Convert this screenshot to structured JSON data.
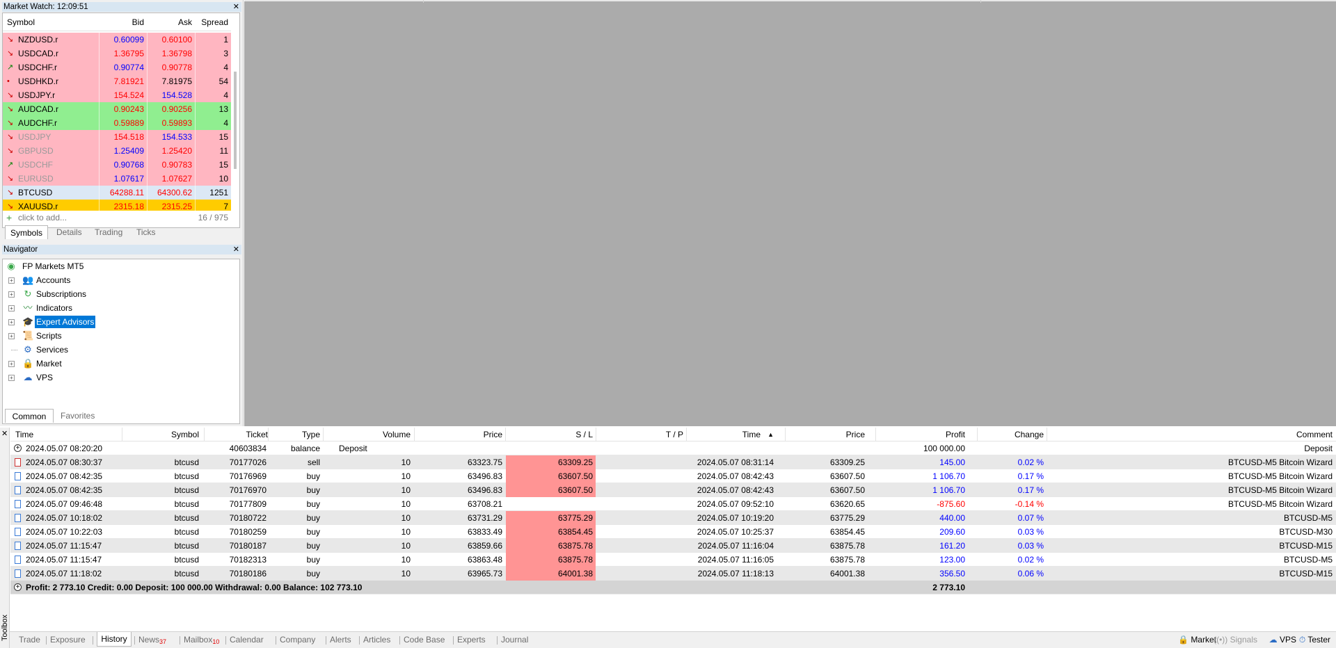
{
  "market_watch": {
    "title": "Market Watch: 12:09:51",
    "columns": {
      "symbol": "Symbol",
      "bid": "Bid",
      "ask": "Ask",
      "spread": "Spread"
    },
    "rows": [
      {
        "symbol": "NZDUSD.r",
        "bid": "0.60099",
        "ask": "0.60100",
        "spread": "1",
        "bg": "#ffb6c1",
        "arrow": "↘",
        "arrow_color": "#cc0000",
        "bid_color": "#0000ff",
        "ask_color": "#ff0000",
        "sym_color": "#000000"
      },
      {
        "symbol": "USDCAD.r",
        "bid": "1.36795",
        "ask": "1.36798",
        "spread": "3",
        "bg": "#ffb6c1",
        "arrow": "↘",
        "arrow_color": "#cc0000",
        "bid_color": "#ff0000",
        "ask_color": "#ff0000",
        "sym_color": "#000000"
      },
      {
        "symbol": "USDCHF.r",
        "bid": "0.90774",
        "ask": "0.90778",
        "spread": "4",
        "bg": "#ffb6c1",
        "arrow": "↗",
        "arrow_color": "#008000",
        "bid_color": "#0000ff",
        "ask_color": "#ff0000",
        "sym_color": "#000000"
      },
      {
        "symbol": "USDHKD.r",
        "bid": "7.81921",
        "ask": "7.81975",
        "spread": "54",
        "bg": "#ffb6c1",
        "arrow": "•",
        "arrow_color": "#cc0000",
        "bid_color": "#ff0000",
        "ask_color": "#000000",
        "sym_color": "#000000"
      },
      {
        "symbol": "USDJPY.r",
        "bid": "154.524",
        "ask": "154.528",
        "spread": "4",
        "bg": "#ffb6c1",
        "arrow": "↘",
        "arrow_color": "#cc0000",
        "bid_color": "#ff0000",
        "ask_color": "#0000ff",
        "sym_color": "#000000"
      },
      {
        "symbol": "AUDCAD.r",
        "bid": "0.90243",
        "ask": "0.90256",
        "spread": "13",
        "bg": "#90ee90",
        "arrow": "↘",
        "arrow_color": "#cc0000",
        "bid_color": "#ff0000",
        "ask_color": "#ff0000",
        "sym_color": "#000000"
      },
      {
        "symbol": "AUDCHF.r",
        "bid": "0.59889",
        "ask": "0.59893",
        "spread": "4",
        "bg": "#90ee90",
        "arrow": "↘",
        "arrow_color": "#cc0000",
        "bid_color": "#ff0000",
        "ask_color": "#ff0000",
        "sym_color": "#000000"
      },
      {
        "symbol": "USDJPY",
        "bid": "154.518",
        "ask": "154.533",
        "spread": "15",
        "bg": "#ffb6c1",
        "arrow": "↘",
        "arrow_color": "#cc0000",
        "bid_color": "#ff0000",
        "ask_color": "#0000ff",
        "sym_color": "#9a9a9a"
      },
      {
        "symbol": "GBPUSD",
        "bid": "1.25409",
        "ask": "1.25420",
        "spread": "11",
        "bg": "#ffb6c1",
        "arrow": "↘",
        "arrow_color": "#cc0000",
        "bid_color": "#0000ff",
        "ask_color": "#ff0000",
        "sym_color": "#9a9a9a"
      },
      {
        "symbol": "USDCHF",
        "bid": "0.90768",
        "ask": "0.90783",
        "spread": "15",
        "bg": "#ffb6c1",
        "arrow": "↗",
        "arrow_color": "#008000",
        "bid_color": "#0000ff",
        "ask_color": "#ff0000",
        "sym_color": "#9a9a9a"
      },
      {
        "symbol": "EURUSD",
        "bid": "1.07617",
        "ask": "1.07627",
        "spread": "10",
        "bg": "#ffb6c1",
        "arrow": "↘",
        "arrow_color": "#cc0000",
        "bid_color": "#0000ff",
        "ask_color": "#ff0000",
        "sym_color": "#9a9a9a"
      },
      {
        "symbol": "BTCUSD",
        "bid": "64288.11",
        "ask": "64300.62",
        "spread": "1251",
        "bg": "#dce8f5",
        "arrow": "↘",
        "arrow_color": "#cc0000",
        "bid_color": "#ff0000",
        "ask_color": "#ff0000",
        "sym_color": "#000000"
      },
      {
        "symbol": "XAUUSD.r",
        "bid": "2315.18",
        "ask": "2315.25",
        "spread": "7",
        "bg": "#ffcc00",
        "arrow": "↘",
        "arrow_color": "#cc0000",
        "bid_color": "#ff0000",
        "ask_color": "#ff0000",
        "sym_color": "#000000"
      }
    ],
    "add_label": "click to add...",
    "count": "16 / 975",
    "tabs": [
      "Symbols",
      "Details",
      "Trading",
      "Ticks"
    ]
  },
  "navigator": {
    "title": "Navigator",
    "root": "FP Markets MT5",
    "items": [
      {
        "label": "Accounts",
        "icon": "accounts-icon",
        "glyph": "👥",
        "color": "#2b6cc4",
        "expandable": true
      },
      {
        "label": "Subscriptions",
        "icon": "subscriptions-icon",
        "glyph": "↻",
        "color": "#3aa84a",
        "expandable": true
      },
      {
        "label": "Indicators",
        "icon": "indicators-icon",
        "glyph": "〰",
        "color": "#2a8a3a",
        "expandable": true
      },
      {
        "label": "Expert Advisors",
        "icon": "expert-advisors-icon",
        "glyph": "🎓",
        "color": "#2b6cc4",
        "expandable": true,
        "selected": true
      },
      {
        "label": "Scripts",
        "icon": "scripts-icon",
        "glyph": "📜",
        "color": "#e0a800",
        "expandable": true
      },
      {
        "label": "Services",
        "icon": "services-icon",
        "glyph": "⚙",
        "color": "#2b6cc4",
        "expandable": false
      },
      {
        "label": "Market",
        "icon": "market-icon",
        "glyph": "🔒",
        "color": "#e0a800",
        "expandable": true
      },
      {
        "label": "VPS",
        "icon": "vps-icon",
        "glyph": "☁",
        "color": "#2b6cc4",
        "expandable": true
      }
    ],
    "tabs": [
      "Common",
      "Favorites"
    ]
  },
  "history": {
    "columns": {
      "time": "Time",
      "symbol": "Symbol",
      "ticket": "Ticket",
      "type": "Type",
      "volume": "Volume",
      "price": "Price",
      "sl": "S / L",
      "tp": "T / P",
      "time2": "Time",
      "price2": "Price",
      "profit": "Profit",
      "change": "Change",
      "comment": "Comment"
    },
    "balance_row": {
      "time": "2024.05.07 08:20:20",
      "ticket": "40603834",
      "type": "balance",
      "volume": "Deposit",
      "profit": "100 000.00",
      "comment": "Deposit"
    },
    "rows": [
      {
        "time": "2024.05.07 08:30:37",
        "symbol": "btcusd",
        "ticket": "70177026",
        "type": "sell",
        "volume": "10",
        "price": "63323.75",
        "sl": "63309.25",
        "tp": "",
        "time2": "2024.05.07 08:31:14",
        "price2": "63309.25",
        "profit": "145.00",
        "change": "0.02 %",
        "comment": "BTCUSD-M5 Bitcoin Wizard",
        "neg": false
      },
      {
        "time": "2024.05.07 08:42:35",
        "symbol": "btcusd",
        "ticket": "70176969",
        "type": "buy",
        "volume": "10",
        "price": "63496.83",
        "sl": "63607.50",
        "tp": "",
        "time2": "2024.05.07 08:42:43",
        "price2": "63607.50",
        "profit": "1 106.70",
        "change": "0.17 %",
        "comment": "BTCUSD-M5 Bitcoin Wizard",
        "neg": false
      },
      {
        "time": "2024.05.07 08:42:35",
        "symbol": "btcusd",
        "ticket": "70176970",
        "type": "buy",
        "volume": "10",
        "price": "63496.83",
        "sl": "63607.50",
        "tp": "",
        "time2": "2024.05.07 08:42:43",
        "price2": "63607.50",
        "profit": "1 106.70",
        "change": "0.17 %",
        "comment": "BTCUSD-M5 Bitcoin Wizard",
        "neg": false
      },
      {
        "time": "2024.05.07 09:46:48",
        "symbol": "btcusd",
        "ticket": "70177809",
        "type": "buy",
        "volume": "10",
        "price": "63708.21",
        "sl": "",
        "tp": "",
        "time2": "2024.05.07 09:52:10",
        "price2": "63620.65",
        "profit": "-875.60",
        "change": "-0.14 %",
        "comment": "BTCUSD-M5 Bitcoin Wizard",
        "neg": true
      },
      {
        "time": "2024.05.07 10:18:02",
        "symbol": "btcusd",
        "ticket": "70180722",
        "type": "buy",
        "volume": "10",
        "price": "63731.29",
        "sl": "63775.29",
        "tp": "",
        "time2": "2024.05.07 10:19:20",
        "price2": "63775.29",
        "profit": "440.00",
        "change": "0.07 %",
        "comment": "BTCUSD-M5",
        "neg": false
      },
      {
        "time": "2024.05.07 10:22:03",
        "symbol": "btcusd",
        "ticket": "70180259",
        "type": "buy",
        "volume": "10",
        "price": "63833.49",
        "sl": "63854.45",
        "tp": "",
        "time2": "2024.05.07 10:25:37",
        "price2": "63854.45",
        "profit": "209.60",
        "change": "0.03 %",
        "comment": "BTCUSD-M30",
        "neg": false
      },
      {
        "time": "2024.05.07 11:15:47",
        "symbol": "btcusd",
        "ticket": "70180187",
        "type": "buy",
        "volume": "10",
        "price": "63859.66",
        "sl": "63875.78",
        "tp": "",
        "time2": "2024.05.07 11:16:04",
        "price2": "63875.78",
        "profit": "161.20",
        "change": "0.03 %",
        "comment": "BTCUSD-M15",
        "neg": false
      },
      {
        "time": "2024.05.07 11:15:47",
        "symbol": "btcusd",
        "ticket": "70182313",
        "type": "buy",
        "volume": "10",
        "price": "63863.48",
        "sl": "63875.78",
        "tp": "",
        "time2": "2024.05.07 11:16:05",
        "price2": "63875.78",
        "profit": "123.00",
        "change": "0.02 %",
        "comment": "BTCUSD-M5",
        "neg": false
      },
      {
        "time": "2024.05.07 11:18:02",
        "symbol": "btcusd",
        "ticket": "70180186",
        "type": "buy",
        "volume": "10",
        "price": "63965.73",
        "sl": "64001.38",
        "tp": "",
        "time2": "2024.05.07 11:18:13",
        "price2": "64001.38",
        "profit": "356.50",
        "change": "0.06 %",
        "comment": "BTCUSD-M15",
        "neg": false
      }
    ],
    "summary": {
      "text": "Profit: 2 773.10  Credit: 0.00  Deposit: 100 000.00  Withdrawal: 0.00  Balance: 102 773.10",
      "profit": "2 773.10"
    }
  },
  "toolbox": {
    "label": "Toolbox",
    "tabs": [
      {
        "label": "Trade",
        "badge": ""
      },
      {
        "label": "Exposure",
        "badge": ""
      },
      {
        "label": "History",
        "badge": "",
        "active": true
      },
      {
        "label": "News",
        "badge": "37"
      },
      {
        "label": "Mailbox",
        "badge": "10"
      },
      {
        "label": "Calendar",
        "badge": ""
      },
      {
        "label": "Company",
        "badge": ""
      },
      {
        "label": "Alerts",
        "badge": ""
      },
      {
        "label": "Articles",
        "badge": ""
      },
      {
        "label": "Code Base",
        "badge": ""
      },
      {
        "label": "Experts",
        "badge": ""
      },
      {
        "label": "Journal",
        "badge": ""
      }
    ],
    "right": {
      "market": "Market",
      "signals": "Signals",
      "vps": "VPS",
      "tester": "Tester"
    }
  }
}
